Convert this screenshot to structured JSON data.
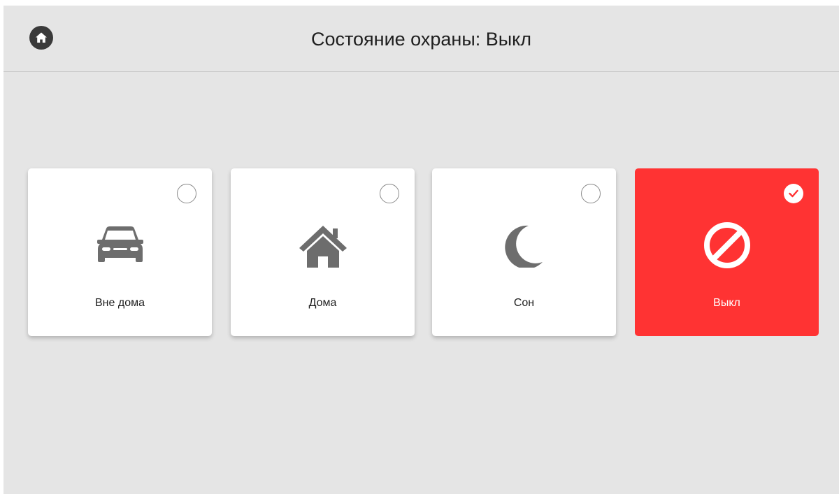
{
  "header": {
    "title": "Состояние охраны: Выкл",
    "home_icon": "home-icon"
  },
  "modes": [
    {
      "label": "Вне дома",
      "icon": "car-icon",
      "selected": false
    },
    {
      "label": "Дома",
      "icon": "house-icon",
      "selected": false
    },
    {
      "label": "Сон",
      "icon": "moon-icon",
      "selected": false
    },
    {
      "label": "Выкл",
      "icon": "prohibited-icon",
      "selected": true
    }
  ],
  "colors": {
    "background": "#e5e5e5",
    "card": "#ffffff",
    "active_card": "#ff3333",
    "icon": "#6d6d6d",
    "home_button": "#3a3a3a"
  }
}
